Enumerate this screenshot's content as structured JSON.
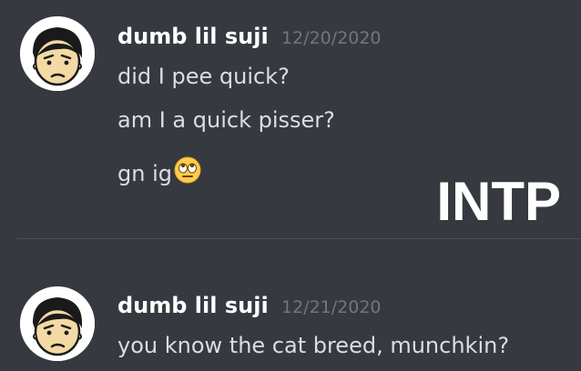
{
  "messages": [
    {
      "author": "dumb lil suji",
      "timestamp": "12/20/2020",
      "lines": [
        "did I pee quick?",
        "am I a quick pisser?",
        "gn ig"
      ],
      "emoji": "eye-roll-emoji"
    },
    {
      "author": "dumb lil suji",
      "timestamp": "12/21/2020",
      "lines": [
        "you know the cat breed, munchkin?"
      ]
    }
  ],
  "overlay": {
    "text": "INTP"
  },
  "colors": {
    "background": "#36393f",
    "author": "#ffffff",
    "message_text": "#dcddde",
    "timestamp": "#72767d"
  }
}
